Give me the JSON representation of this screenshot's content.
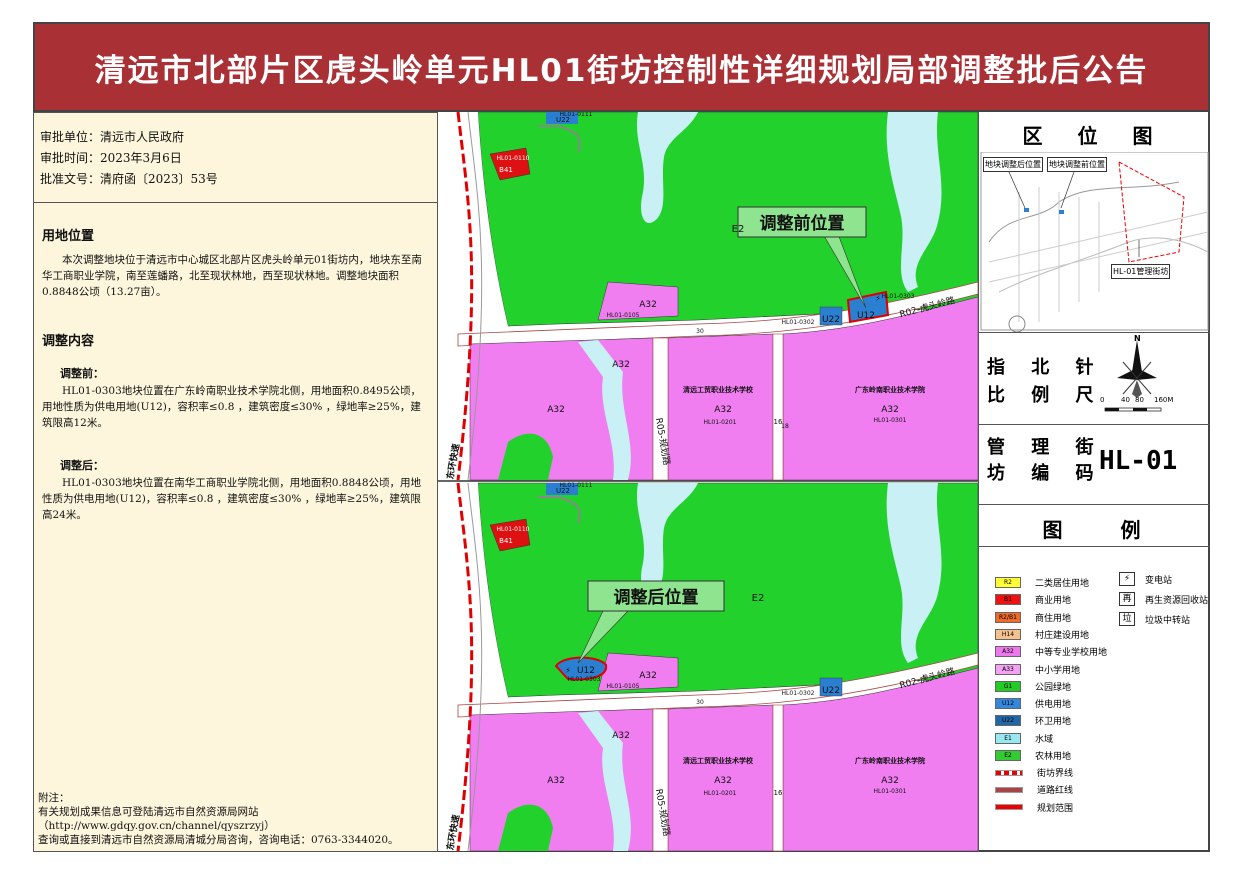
{
  "title": "清远市北部片区虎头岭单元HL01街坊控制性详细规划局部调整批后公告",
  "approval": {
    "unit": "审批单位：清远市人民政府",
    "time": "审批时间：2023年3月6日",
    "doc": "批准文号：清府函〔2023〕53号"
  },
  "location": {
    "heading": "用地位置",
    "text": "本次调整地块位于清远市中心城区北部片区虎头岭单元01街坊内，地块东至南华工商职业学院，南至莲蟠路，北至现状林地，西至现状林地。调整地块面积0.8848公顷（13.27亩）。"
  },
  "adjust": {
    "heading": "调整内容",
    "before_head": "调整前：",
    "before_text": "HL01-0303地块位置在广东岭南职业技术学院北侧，用地面积0.8495公顷，用地性质为供电用地(U12)，容积率≤0.8 ，建筑密度≤30% ，绿地率≥25%，建筑限高12米。",
    "after_head": "调整后：",
    "after_text": "HL01-0303地块位置在南华工商职业学院北侧，用地面积0.8848公顷，用地性质为供电用地(U12)，容积率≤0.8 ，建筑密度≤30% ，绿地率≥25%，建筑限高24米。"
  },
  "note": {
    "line1": "附注：",
    "line2": "有关规划成果信息可登陆清远市自然资源局网站",
    "line3": "（http://www.gdqy.gov.cn/channel/qyszrzyj）",
    "line4": "查询或直接到清远市自然资源局清城分局咨询，咨询电话：0763-3344020。"
  },
  "map_top": {
    "callout": "调整前位置",
    "labels": {
      "a32_north": "A32",
      "a32_left": "A32",
      "a32_mid": "A32",
      "a32_center": "A32",
      "a32_right": "A32",
      "u12": "U12",
      "u22": "U22",
      "u22_top": "U22",
      "b41": "B41",
      "e2": "E2",
      "p0105": "HL01-0105",
      "p0302": "HL01-0302",
      "p0303": "HL01-0303",
      "p0110": "HL01-0110",
      "p0111": "HL01-0111",
      "p0201": "HL01-0201",
      "p0301": "HL01-0301",
      "school1": "清远工贸职业技术学校",
      "school2": "广东岭南职业技术学院",
      "road_r02": "R02-虎头岭路",
      "road_r05": "R05-规划路",
      "road_east": "东环快速",
      "num_16": "16",
      "num_15": "18",
      "num_30": "30"
    }
  },
  "map_bottom": {
    "callout": "调整后位置",
    "labels": {
      "a32_north": "A32",
      "a32_left": "A32",
      "a32_mid": "A32",
      "a32_center": "A32",
      "a32_right": "A32",
      "u12": "U12",
      "u22": "U22",
      "u22_top": "U22",
      "b41": "B41",
      "e2": "E2",
      "p0105": "HL01-0105",
      "p0302": "HL01-0302",
      "p0303": "HL01-0303",
      "p0110": "HL01-0110",
      "p0111": "HL01-0111",
      "p0201": "HL01-0201",
      "p0301": "HL01-0301",
      "school1": "清远工贸职业技术学校",
      "school2": "广东岭南职业技术学院",
      "road_r02": "R02-虎头岭路",
      "road_r05": "R05-规划路",
      "road_east": "东环快速",
      "num_16": "16",
      "num_30": "30"
    }
  },
  "right": {
    "location_title": "区 位 图",
    "loc_after": "地块调整后位置",
    "loc_before": "地块调整前位置",
    "loc_block": "HL-01管理街坊",
    "north_label_1": "指 北 针",
    "north_label_2": "比 例 尺",
    "north_letter": "N",
    "scale_0": "0",
    "scale_40": "40",
    "scale_80": "80",
    "scale_160": "160M",
    "code_label_1": "管 理 街",
    "code_label_2": "坊 编 码",
    "code": "HL-01",
    "legend_title": "图　　例"
  },
  "legend": {
    "left": [
      {
        "code": "R2",
        "label": "二类居住用地",
        "color": "#ffff33"
      },
      {
        "code": "B1",
        "label": "商业用地",
        "color": "#ee1111"
      },
      {
        "code": "R2/B1",
        "label": "商住用地",
        "color": "#f06a2a"
      },
      {
        "code": "H14",
        "label": "村庄建设用地",
        "color": "#f5c28e"
      },
      {
        "code": "A32",
        "label": "中等专业学校用地",
        "color": "#ee77ee"
      },
      {
        "code": "A33",
        "label": "中小学用地",
        "color": "#f4a0f4"
      },
      {
        "code": "G1",
        "label": "公园绿地",
        "color": "#22cc22"
      },
      {
        "code": "U12",
        "label": "供电用地",
        "color": "#3388dd"
      },
      {
        "code": "U22",
        "label": "环卫用地",
        "color": "#2266aa"
      },
      {
        "code": "E1",
        "label": "水域",
        "color": "#99e8f0"
      },
      {
        "code": "E2",
        "label": "农林用地",
        "color": "#33cc33"
      }
    ],
    "lines": [
      {
        "label": "街坊界线"
      },
      {
        "label": "道路红线"
      },
      {
        "label": "规划范围"
      }
    ],
    "right": [
      {
        "sym": "⚡",
        "label": "变电站"
      },
      {
        "sym": "再",
        "label": "再生资源回收站"
      },
      {
        "sym": "垃",
        "label": "垃圾中转站"
      }
    ]
  },
  "colors": {
    "title_bg": "#a93136",
    "green": "#23d12c",
    "pink": "#f07ef0",
    "water": "#c8f0f5",
    "blue": "#2a7fd0",
    "red": "#e00000"
  }
}
